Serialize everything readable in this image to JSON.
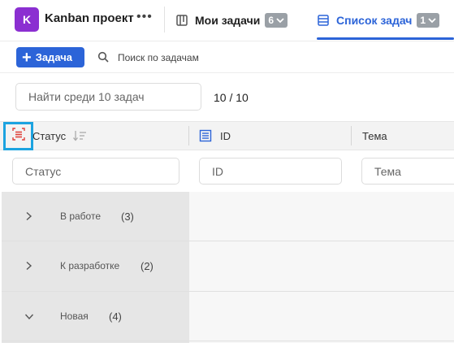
{
  "project": {
    "avatar_letter": "K",
    "name": "Kanban проект",
    "more": "•••"
  },
  "tabs": [
    {
      "label": "Мои задачи",
      "badge": "6"
    },
    {
      "label": "Список задач",
      "badge": "1",
      "active": true
    }
  ],
  "toolbar": {
    "add_label": "Задача",
    "search_label": "Поиск по задачам"
  },
  "filter": {
    "placeholder": "Найти среди 10 задач",
    "counter": "10 / 10"
  },
  "columns": {
    "status": "Статус",
    "id": "ID",
    "theme": "Тема"
  },
  "column_filters": {
    "status": "Статус",
    "id": "ID",
    "theme": "Тема"
  },
  "groups": [
    {
      "label": "В работе",
      "count": "(3)",
      "expanded": false
    },
    {
      "label": "К разработке",
      "count": "(2)",
      "expanded": false
    },
    {
      "label": "Новая",
      "count": "(4)",
      "expanded": true
    }
  ],
  "colors": {
    "accent": "#2c64d8",
    "avatar": "#8b2fd1",
    "highlight": "#1ca3e0",
    "group_icon": "#e0413a"
  }
}
